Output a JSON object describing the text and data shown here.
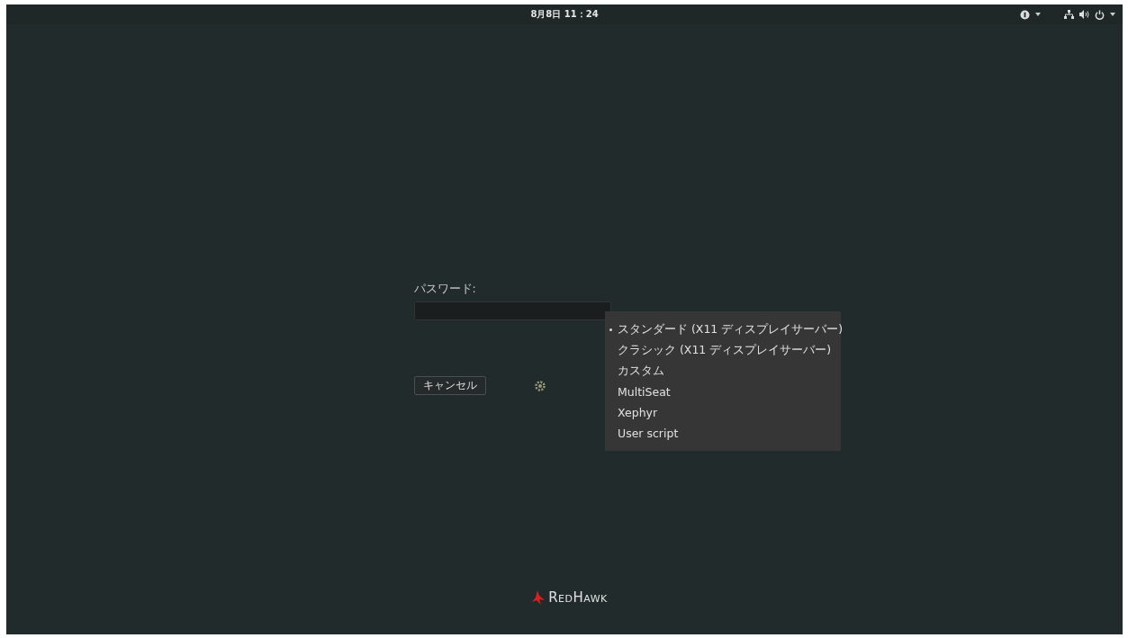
{
  "top_bar": {
    "clock": "8月8日 11：24"
  },
  "login": {
    "label": "パスワード:",
    "cancel_button": "キャンセル"
  },
  "session_menu": {
    "items": [
      {
        "label": "スタンダード (X11 ディスプレイサーバー)",
        "selected": true
      },
      {
        "label": "クラシック (X11 ディスプレイサーバー)",
        "selected": false
      },
      {
        "label": "カスタム",
        "selected": false
      },
      {
        "label": "MultiSeat",
        "selected": false
      },
      {
        "label": "Xephyr",
        "selected": false
      },
      {
        "label": "User script",
        "selected": false
      }
    ]
  },
  "logo": {
    "text": "RedHawk"
  }
}
